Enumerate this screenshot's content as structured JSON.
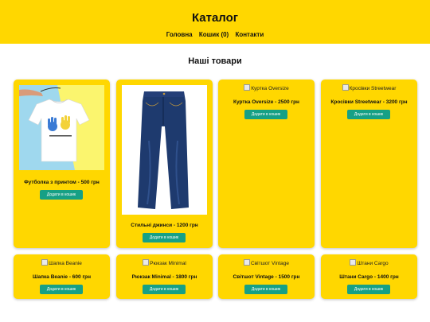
{
  "header": {
    "title": "Каталог"
  },
  "nav": {
    "home": "Головна",
    "cart": "Кошик (0)",
    "contacts": "Контакти"
  },
  "section": {
    "title": "Наші товари"
  },
  "products": [
    {
      "name": "Футболка з принтом - 500 грн",
      "alt": "",
      "button": "Додати в кошик"
    },
    {
      "name": "Стильні джинси - 1200 грн",
      "alt": "",
      "button": "Додати в кошик"
    },
    {
      "name": "Куртка Oversize - 2500 грн",
      "alt": "Куртка Oversize",
      "button": "Додати в кошик"
    },
    {
      "name": "Кросівки Streetwear - 3200 грн",
      "alt": "Кросівки Streetwear",
      "button": "Додати в кошик"
    },
    {
      "name": "Шапка Beanie - 600 грн",
      "alt": "Шапка Beanie",
      "button": "Додати в кошик"
    },
    {
      "name": "Рюкзак Minimal - 1800 грн",
      "alt": "Рюкзак Minimal",
      "button": "Додати в кошик"
    },
    {
      "name": "Світшот Vintage - 1500 грн",
      "alt": "Світшот Vintage",
      "button": "Додати в кошик"
    },
    {
      "name": "Штани Cargo - 1400 грн",
      "alt": "Штани Cargo",
      "button": "Додати в кошик"
    }
  ],
  "colors": {
    "header_bg": "#ffd700",
    "card_bg": "#ffd700",
    "button_bg": "#16a085"
  }
}
